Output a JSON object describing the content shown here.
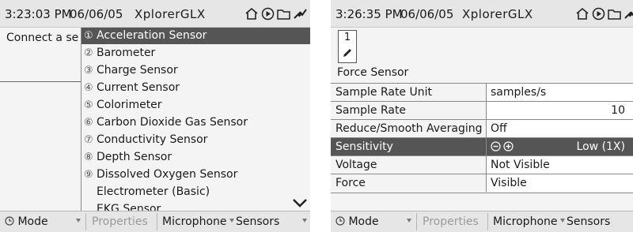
{
  "left": {
    "status": {
      "time": "3:23:03 PM",
      "date": "06/06/05",
      "app": "XplorerGLX"
    },
    "connect_text": "Connect a se",
    "sensor_list": [
      {
        "num": "①",
        "label": "Acceleration Sensor",
        "selected": true
      },
      {
        "num": "②",
        "label": "Barometer"
      },
      {
        "num": "③",
        "label": "Charge Sensor"
      },
      {
        "num": "④",
        "label": "Current Sensor"
      },
      {
        "num": "⑤",
        "label": "Colorimeter"
      },
      {
        "num": "⑥",
        "label": "Carbon Dioxide Gas Sensor"
      },
      {
        "num": "⑦",
        "label": "Conductivity Sensor"
      },
      {
        "num": "⑧",
        "label": "Depth Sensor"
      },
      {
        "num": "⑨",
        "label": "Dissolved Oxygen Sensor"
      },
      {
        "num": "",
        "label": "Electrometer (Basic)"
      },
      {
        "num": "",
        "label": "EKG Sensor"
      }
    ],
    "bottom": {
      "mode": "Mode",
      "properties": "Properties",
      "microphone": "Microphone",
      "sensors": "Sensors"
    }
  },
  "right": {
    "status": {
      "time": "3:26:35 PM",
      "date": "06/06/05",
      "app": "XplorerGLX"
    },
    "sensor_number": "1",
    "sensor_title": "Force Sensor",
    "properties": [
      {
        "label": "Sample Rate Unit",
        "value": "samples/s"
      },
      {
        "label": "Sample Rate",
        "value": "10"
      },
      {
        "label": "Reduce/Smooth Averaging",
        "value": "Off"
      },
      {
        "label": "Sensitivity",
        "value": "Low (1X)"
      },
      {
        "label": "Voltage",
        "value": "Not Visible"
      },
      {
        "label": "Force",
        "value": "Visible"
      }
    ],
    "bottom": {
      "mode": "Mode",
      "properties": "Properties",
      "microphone": "Microphone",
      "sensors": "Sensors"
    }
  },
  "colors": {
    "highlight": "#555555",
    "status_bg": "#e6e6e6",
    "content_bg": "#f4f4f4"
  },
  "icons": [
    "home-icon",
    "play-icon",
    "folder-icon",
    "sensor-plug-icon",
    "clock-icon",
    "pencil-icon",
    "minus-circle-icon",
    "plus-circle-icon",
    "chevron-down-icon"
  ]
}
